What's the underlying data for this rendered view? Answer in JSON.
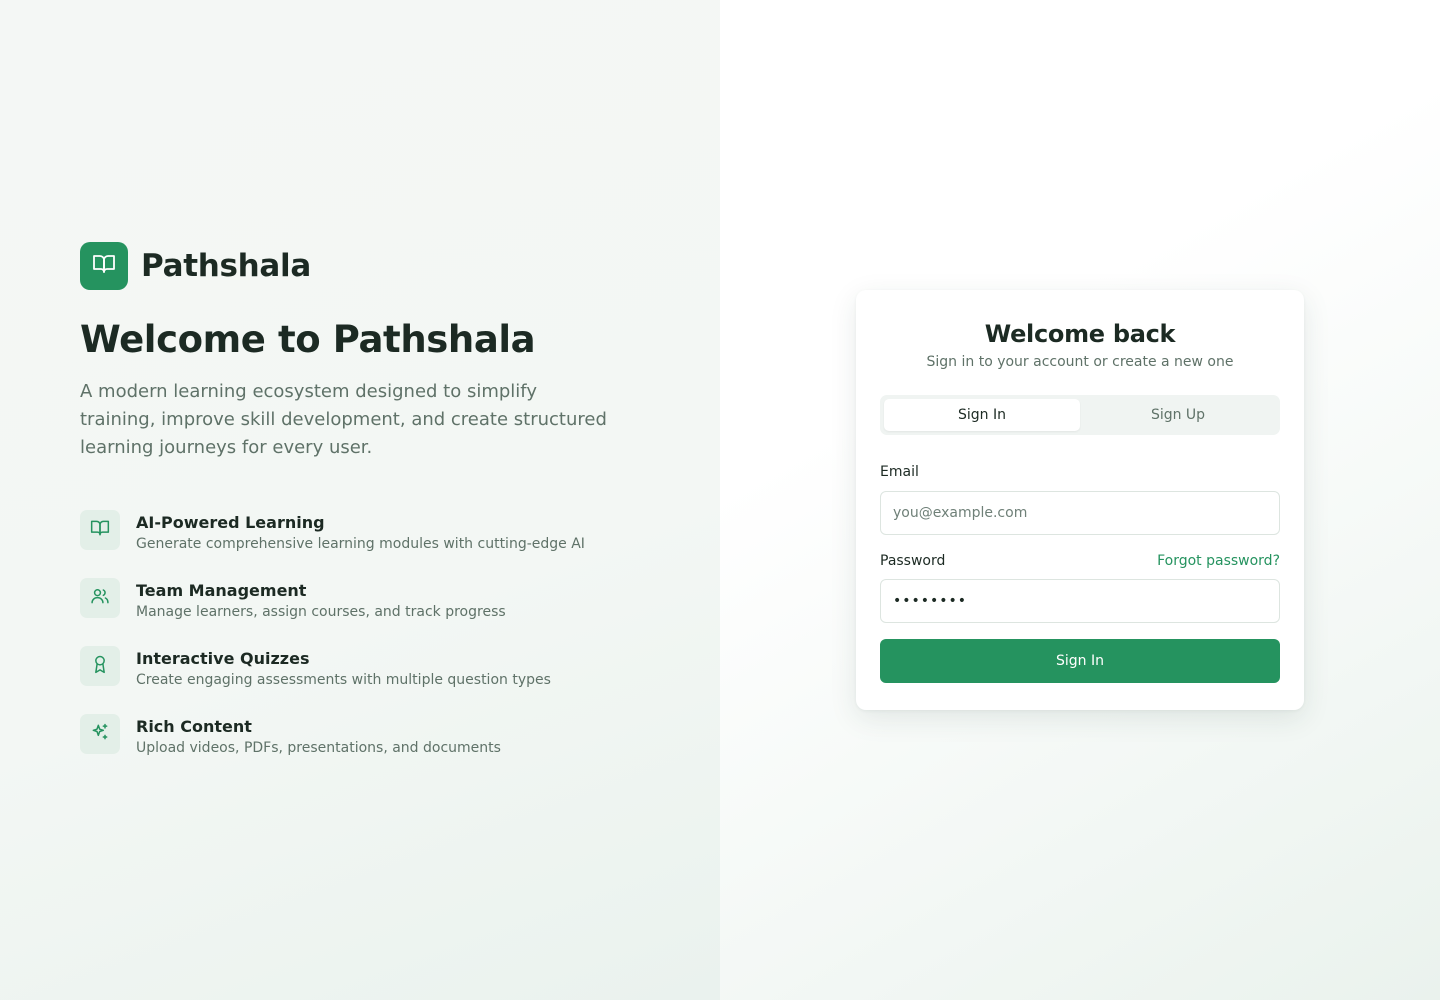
{
  "brand": {
    "name": "Pathshala",
    "logo_icon": "book-open-icon",
    "accent_color": "#25935f"
  },
  "hero": {
    "title": "Welcome to Pathshala",
    "description": "A modern learning ecosystem designed to simplify training, improve skill development, and create structured learning journeys for every user."
  },
  "features": [
    {
      "icon": "book-open-icon",
      "title": "AI-Powered Learning",
      "description": "Generate comprehensive learning modules with cutting-edge AI"
    },
    {
      "icon": "users-icon",
      "title": "Team Management",
      "description": "Manage learners, assign courses, and track progress"
    },
    {
      "icon": "award-icon",
      "title": "Interactive Quizzes",
      "description": "Create engaging assessments with multiple question types"
    },
    {
      "icon": "sparkles-icon",
      "title": "Rich Content",
      "description": "Upload videos, PDFs, presentations, and documents"
    }
  ],
  "auth": {
    "title": "Welcome back",
    "subtitle": "Sign in to your account or create a new one",
    "tabs": [
      {
        "label": "Sign In",
        "active": true
      },
      {
        "label": "Sign Up",
        "active": false
      }
    ],
    "email": {
      "label": "Email",
      "placeholder": "you@example.com",
      "value": ""
    },
    "password": {
      "label": "Password",
      "value": "••••••••",
      "forgot_label": "Forgot password?"
    },
    "submit_label": "Sign In"
  }
}
